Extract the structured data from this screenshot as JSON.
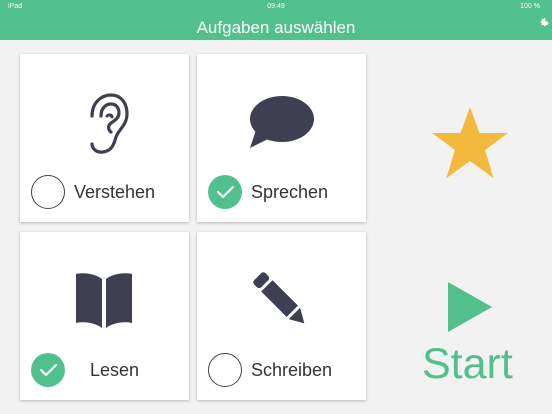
{
  "status_bar": {
    "left": "iPad",
    "time": "09:49",
    "battery": "100 %"
  },
  "header": {
    "title": "Aufgaben auswählen"
  },
  "tasks": [
    {
      "label": "Verstehen",
      "checked": false,
      "icon": "ear-icon"
    },
    {
      "label": "Sprechen",
      "checked": true,
      "icon": "speech-bubble-icon"
    },
    {
      "label": "Lesen",
      "checked": true,
      "icon": "book-icon"
    },
    {
      "label": "Schreiben",
      "checked": false,
      "icon": "pencil-icon"
    }
  ],
  "start": {
    "label": "Start"
  },
  "colors": {
    "accent": "#52c08c",
    "icon_dark": "#3e3f52",
    "star": "#f3b93d"
  }
}
